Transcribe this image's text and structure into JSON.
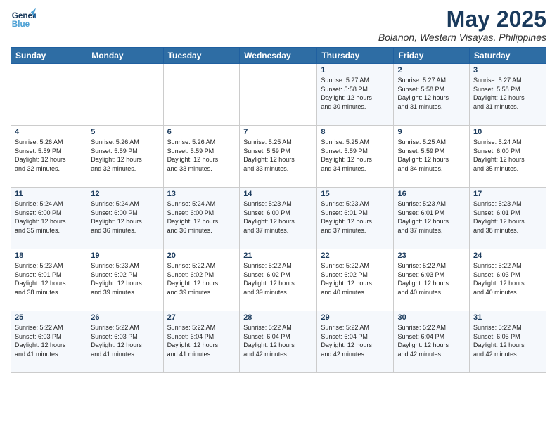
{
  "logo": {
    "line1": "General",
    "line2": "Blue"
  },
  "title": "May 2025",
  "subtitle": "Bolanon, Western Visayas, Philippines",
  "header_days": [
    "Sunday",
    "Monday",
    "Tuesday",
    "Wednesday",
    "Thursday",
    "Friday",
    "Saturday"
  ],
  "weeks": [
    [
      {
        "day": "",
        "info": ""
      },
      {
        "day": "",
        "info": ""
      },
      {
        "day": "",
        "info": ""
      },
      {
        "day": "",
        "info": ""
      },
      {
        "day": "1",
        "info": "Sunrise: 5:27 AM\nSunset: 5:58 PM\nDaylight: 12 hours\nand 30 minutes."
      },
      {
        "day": "2",
        "info": "Sunrise: 5:27 AM\nSunset: 5:58 PM\nDaylight: 12 hours\nand 31 minutes."
      },
      {
        "day": "3",
        "info": "Sunrise: 5:27 AM\nSunset: 5:58 PM\nDaylight: 12 hours\nand 31 minutes."
      }
    ],
    [
      {
        "day": "4",
        "info": "Sunrise: 5:26 AM\nSunset: 5:59 PM\nDaylight: 12 hours\nand 32 minutes."
      },
      {
        "day": "5",
        "info": "Sunrise: 5:26 AM\nSunset: 5:59 PM\nDaylight: 12 hours\nand 32 minutes."
      },
      {
        "day": "6",
        "info": "Sunrise: 5:26 AM\nSunset: 5:59 PM\nDaylight: 12 hours\nand 33 minutes."
      },
      {
        "day": "7",
        "info": "Sunrise: 5:25 AM\nSunset: 5:59 PM\nDaylight: 12 hours\nand 33 minutes."
      },
      {
        "day": "8",
        "info": "Sunrise: 5:25 AM\nSunset: 5:59 PM\nDaylight: 12 hours\nand 34 minutes."
      },
      {
        "day": "9",
        "info": "Sunrise: 5:25 AM\nSunset: 5:59 PM\nDaylight: 12 hours\nand 34 minutes."
      },
      {
        "day": "10",
        "info": "Sunrise: 5:24 AM\nSunset: 6:00 PM\nDaylight: 12 hours\nand 35 minutes."
      }
    ],
    [
      {
        "day": "11",
        "info": "Sunrise: 5:24 AM\nSunset: 6:00 PM\nDaylight: 12 hours\nand 35 minutes."
      },
      {
        "day": "12",
        "info": "Sunrise: 5:24 AM\nSunset: 6:00 PM\nDaylight: 12 hours\nand 36 minutes."
      },
      {
        "day": "13",
        "info": "Sunrise: 5:24 AM\nSunset: 6:00 PM\nDaylight: 12 hours\nand 36 minutes."
      },
      {
        "day": "14",
        "info": "Sunrise: 5:23 AM\nSunset: 6:00 PM\nDaylight: 12 hours\nand 37 minutes."
      },
      {
        "day": "15",
        "info": "Sunrise: 5:23 AM\nSunset: 6:01 PM\nDaylight: 12 hours\nand 37 minutes."
      },
      {
        "day": "16",
        "info": "Sunrise: 5:23 AM\nSunset: 6:01 PM\nDaylight: 12 hours\nand 37 minutes."
      },
      {
        "day": "17",
        "info": "Sunrise: 5:23 AM\nSunset: 6:01 PM\nDaylight: 12 hours\nand 38 minutes."
      }
    ],
    [
      {
        "day": "18",
        "info": "Sunrise: 5:23 AM\nSunset: 6:01 PM\nDaylight: 12 hours\nand 38 minutes."
      },
      {
        "day": "19",
        "info": "Sunrise: 5:23 AM\nSunset: 6:02 PM\nDaylight: 12 hours\nand 39 minutes."
      },
      {
        "day": "20",
        "info": "Sunrise: 5:22 AM\nSunset: 6:02 PM\nDaylight: 12 hours\nand 39 minutes."
      },
      {
        "day": "21",
        "info": "Sunrise: 5:22 AM\nSunset: 6:02 PM\nDaylight: 12 hours\nand 39 minutes."
      },
      {
        "day": "22",
        "info": "Sunrise: 5:22 AM\nSunset: 6:02 PM\nDaylight: 12 hours\nand 40 minutes."
      },
      {
        "day": "23",
        "info": "Sunrise: 5:22 AM\nSunset: 6:03 PM\nDaylight: 12 hours\nand 40 minutes."
      },
      {
        "day": "24",
        "info": "Sunrise: 5:22 AM\nSunset: 6:03 PM\nDaylight: 12 hours\nand 40 minutes."
      }
    ],
    [
      {
        "day": "25",
        "info": "Sunrise: 5:22 AM\nSunset: 6:03 PM\nDaylight: 12 hours\nand 41 minutes."
      },
      {
        "day": "26",
        "info": "Sunrise: 5:22 AM\nSunset: 6:03 PM\nDaylight: 12 hours\nand 41 minutes."
      },
      {
        "day": "27",
        "info": "Sunrise: 5:22 AM\nSunset: 6:04 PM\nDaylight: 12 hours\nand 41 minutes."
      },
      {
        "day": "28",
        "info": "Sunrise: 5:22 AM\nSunset: 6:04 PM\nDaylight: 12 hours\nand 42 minutes."
      },
      {
        "day": "29",
        "info": "Sunrise: 5:22 AM\nSunset: 6:04 PM\nDaylight: 12 hours\nand 42 minutes."
      },
      {
        "day": "30",
        "info": "Sunrise: 5:22 AM\nSunset: 6:04 PM\nDaylight: 12 hours\nand 42 minutes."
      },
      {
        "day": "31",
        "info": "Sunrise: 5:22 AM\nSunset: 6:05 PM\nDaylight: 12 hours\nand 42 minutes."
      }
    ]
  ]
}
